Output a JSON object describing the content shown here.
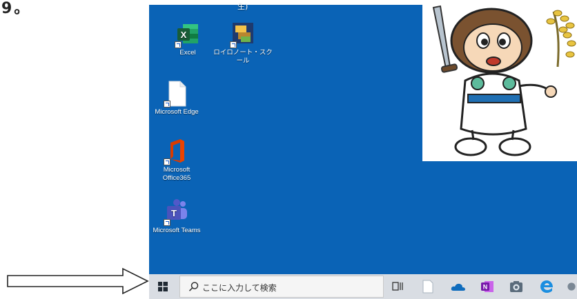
{
  "caption_fragment": "9。",
  "desktop": {
    "top_clipped_text": "生)",
    "icons": [
      {
        "name": "excel",
        "label": "Excel",
        "badge": "X"
      },
      {
        "name": "roilo",
        "label": "ロイロノート・スクール"
      },
      {
        "name": "edge",
        "label": "Microsoft Edge"
      },
      {
        "name": "office365",
        "label_lines": [
          "Microsoft",
          "Office365"
        ]
      },
      {
        "name": "teams",
        "label": "Microsoft Teams",
        "badge": "T"
      }
    ]
  },
  "taskbar": {
    "search_placeholder": "ここに入力して検索",
    "onenote_badge": "N",
    "icons": [
      "task-view-icon",
      "file-explorer-icon",
      "onedrive-icon",
      "onenote-icon",
      "camera-icon",
      "edge-icon"
    ]
  },
  "colors": {
    "desktop_bg": "#0a63b6",
    "taskbar_bg": "#d9dde3",
    "excel_green": "#1e7145",
    "office_red": "#d83b01",
    "teams_purple": "#5059c9",
    "onenote_purple": "#7719aa",
    "edge_blue": "#1b8ee0"
  }
}
